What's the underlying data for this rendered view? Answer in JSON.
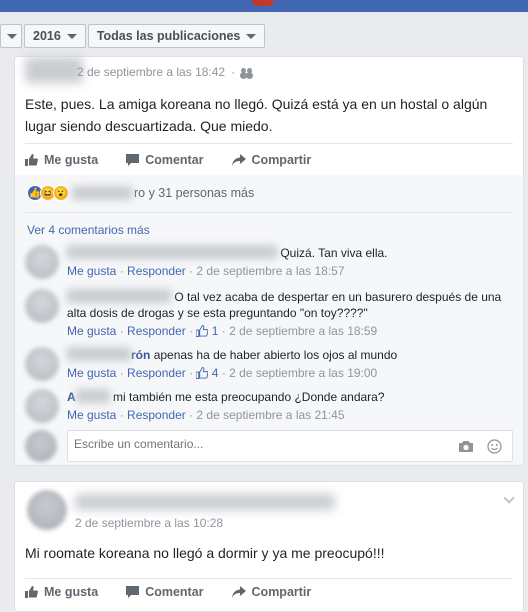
{
  "filters": {
    "year": "2016",
    "scope": "Todas las publicaciones"
  },
  "post1": {
    "timestamp": "2 de septiembre a las 18:42",
    "text": "Este, pues. La amiga koreana no llegó. Quizá está ya en un hostal o algún lugar siendo descuartizada. Que miedo.",
    "actions": {
      "like": "Me gusta",
      "comment": "Comentar",
      "share": "Compartir"
    },
    "reactions_text": "ro y 31 personas más",
    "more_comments": "Ver 4 comentarios más",
    "comments": [
      {
        "text": "Quizá. Tan viva ella.",
        "like": "Me gusta",
        "reply": "Responder",
        "likes": "",
        "time": "2 de septiembre a las 18:57"
      },
      {
        "text": "O tal vez acaba de despertar en un basurero después de una alta dosis de drogas y se esta preguntando \"on toy????\"",
        "like": "Me gusta",
        "reply": "Responder",
        "likes": "1",
        "time": "2 de septiembre a las 18:59"
      },
      {
        "name_fragment": "rón",
        "text": "apenas ha de haber abierto los ojos al mundo",
        "like": "Me gusta",
        "reply": "Responder",
        "likes": "4",
        "time": "2 de septiembre a las 19:00"
      },
      {
        "name_fragment": "A",
        "text": "mi también me esta preocupando ¿Donde andara?",
        "like": "Me gusta",
        "reply": "Responder",
        "likes": "",
        "time": "2 de septiembre a las 21:45"
      }
    ],
    "composer_placeholder": "Escribe un comentario..."
  },
  "post2": {
    "timestamp": "2 de septiembre a las 10:28",
    "text": "Mi roomate koreana no llegó a dormir y ya me preocupó!!!",
    "actions": {
      "like": "Me gusta",
      "comment": "Comentar",
      "share": "Compartir"
    }
  },
  "colors": {
    "link": "#4267b2",
    "name": "#365899",
    "muted": "#90949c",
    "brand": "#4267b2"
  }
}
